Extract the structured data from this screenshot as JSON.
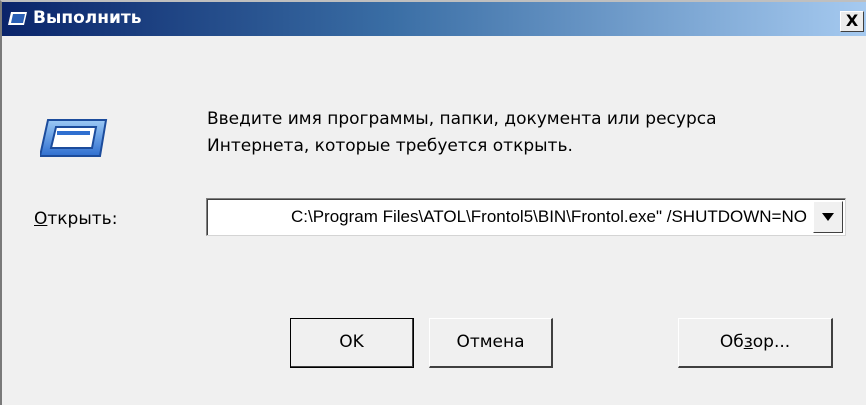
{
  "window": {
    "title": "Выполнить",
    "close_label": "X"
  },
  "prompt": {
    "line1": "Введите имя программы, папки, документа или ресурса",
    "line2": "Интернета, которые требуется открыть."
  },
  "open_field": {
    "label_underlined": "О",
    "label_rest": "ткрыть:",
    "value": "C:\\Program Files\\ATOL\\Frontol5\\BIN\\Frontol.exe\" /SHUTDOWN=NO"
  },
  "buttons": {
    "ok": "OK",
    "cancel": "Отмена",
    "browse_pre": "Об",
    "browse_ul": "з",
    "browse_post": "ор..."
  },
  "icons": {
    "title": "run-dialog-icon",
    "main": "run-program-icon",
    "dropdown": "chevron-down-icon"
  }
}
